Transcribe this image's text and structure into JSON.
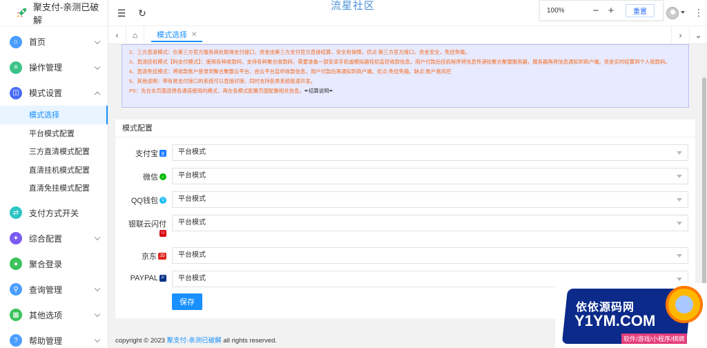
{
  "app": {
    "title": "聚支付-亲测已破解",
    "site_title": "流星社区"
  },
  "sidebar": {
    "items": [
      {
        "label": "首页",
        "icon": "home-icon",
        "color": "#4a9eff"
      },
      {
        "label": "操作管理",
        "icon": "sliders-icon",
        "color": "#3cc389"
      },
      {
        "label": "模式设置",
        "icon": "mode-icon",
        "color": "#4a6cf7"
      },
      {
        "label": "支付方式开关",
        "icon": "switch-icon",
        "color": "#2ec4c4"
      },
      {
        "label": "综合配置",
        "icon": "config-icon",
        "color": "#7a5cf0"
      },
      {
        "label": "聚合登录",
        "icon": "login-icon",
        "color": "#3cc35c"
      },
      {
        "label": "查询管理",
        "icon": "search-icon",
        "color": "#4a9eff"
      },
      {
        "label": "其他选项",
        "icon": "grid-icon",
        "color": "#3cc35c"
      },
      {
        "label": "帮助管理",
        "icon": "help-icon",
        "color": "#4a9eff"
      }
    ],
    "sub_items": [
      "模式选择",
      "平台模式配置",
      "三方直清模式配置",
      "直清挂机模式配置",
      "直清免挂模式配置"
    ]
  },
  "header": {
    "zoom": "100%",
    "zoom_minus": "−",
    "zoom_plus": "+",
    "reset": "重置"
  },
  "tabs": {
    "active": "模式选择"
  },
  "notice": {
    "lines": [
      "2、三方直清模式：在第三方官方服务商处取得支付接口，资金由第三方支付官方直接结算，安全有保障。优点:第三方官方接口，资金安全，免挂免输。",
      "3、直清挂机模式【码支付模式】：使用各种收款码，支持各种聚合收款码，需要准备一部安卓手机或模拟器挂机监控收款信息。用户付款后挂机程序将信息传递给聚合聚盟服务器，服务器再将信息通知到商户端。资金实时结算到个人收款码。",
      "4、直清免挂模式：将收款账户登录到聚合聚盟云平台，由云平台监听收款信息，用户付款后再通知到商户端。优点:免挂免输。缺点:账户易风控",
      "5、其他说明：带有易支付接口的系统可以直接对接，同时支持各类系统极速开发。"
    ],
    "ps": "PS：先在本页面选择各通道使用的模式，再在各模式配置页面配置相关信息。",
    "ps_link": "✒结算说明✒"
  },
  "mode_config": {
    "title": "模式配置",
    "rows": [
      {
        "label": "支付宝",
        "icon": "alipay-icon",
        "badge": "支",
        "badge_color": "#1677ff",
        "value": "平台模式"
      },
      {
        "label": "微信",
        "icon": "wechat-icon",
        "badge": "✓",
        "badge_color": "#09bb07",
        "value": "平台模式"
      },
      {
        "label": "QQ钱包",
        "icon": "qq-wallet-icon",
        "badge": "Q",
        "badge_color": "#12b7f5",
        "value": "平台模式"
      },
      {
        "label": "银联云闪付",
        "icon": "unionpay-icon",
        "badge": "U",
        "badge_color": "#d7000f",
        "value": "平台模式"
      },
      {
        "label": "京东",
        "icon": "jd-icon",
        "badge": "JD",
        "badge_color": "#e1251b",
        "value": "平台模式"
      },
      {
        "label": "PAYPAL",
        "icon": "paypal-icon",
        "badge": "P",
        "badge_color": "#003087",
        "value": "平台模式"
      }
    ],
    "save": "保存"
  },
  "footer": {
    "prefix": "copyright © 2023",
    "link": "聚支付-亲测已破解",
    "suffix": "all rights reserved."
  },
  "watermark": {
    "line1": "依依源码网",
    "line2": "Y1YM.COM",
    "line3": "软件/游戏/小程序/棋牌"
  }
}
